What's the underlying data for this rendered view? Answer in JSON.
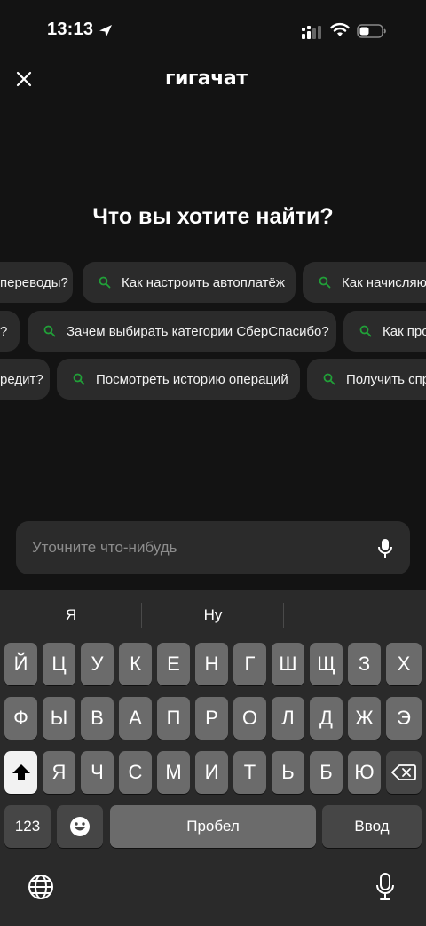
{
  "status_bar": {
    "time": "13:13"
  },
  "header": {
    "brand": "гигачат"
  },
  "title": "Что вы хотите найти?",
  "suggestions": [
    [
      "переводы?",
      "Как настроить автоплатёж",
      "Как начисляют"
    ],
    [
      "?",
      "Зачем выбирать категории СберСпасибо?",
      "Как про"
    ],
    [
      "редит?",
      "Посмотреть историю операций",
      "Получить спр"
    ]
  ],
  "input": {
    "placeholder": "Уточните что-нибудь"
  },
  "keyboard": {
    "predictions": [
      "Я",
      "Ну",
      ""
    ],
    "row1": [
      "Й",
      "Ц",
      "У",
      "К",
      "Е",
      "Н",
      "Г",
      "Ш",
      "Щ",
      "З",
      "Х"
    ],
    "row2": [
      "Ф",
      "Ы",
      "В",
      "А",
      "П",
      "Р",
      "О",
      "Л",
      "Д",
      "Ж",
      "Э"
    ],
    "row3": [
      "Я",
      "Ч",
      "С",
      "М",
      "И",
      "Т",
      "Ь",
      "Б",
      "Ю"
    ],
    "numbers_label": "123",
    "space_label": "Пробел",
    "enter_label": "Ввод"
  },
  "colors": {
    "accent": "#21a038",
    "background": "#131313",
    "chip": "#2b2b2b"
  }
}
